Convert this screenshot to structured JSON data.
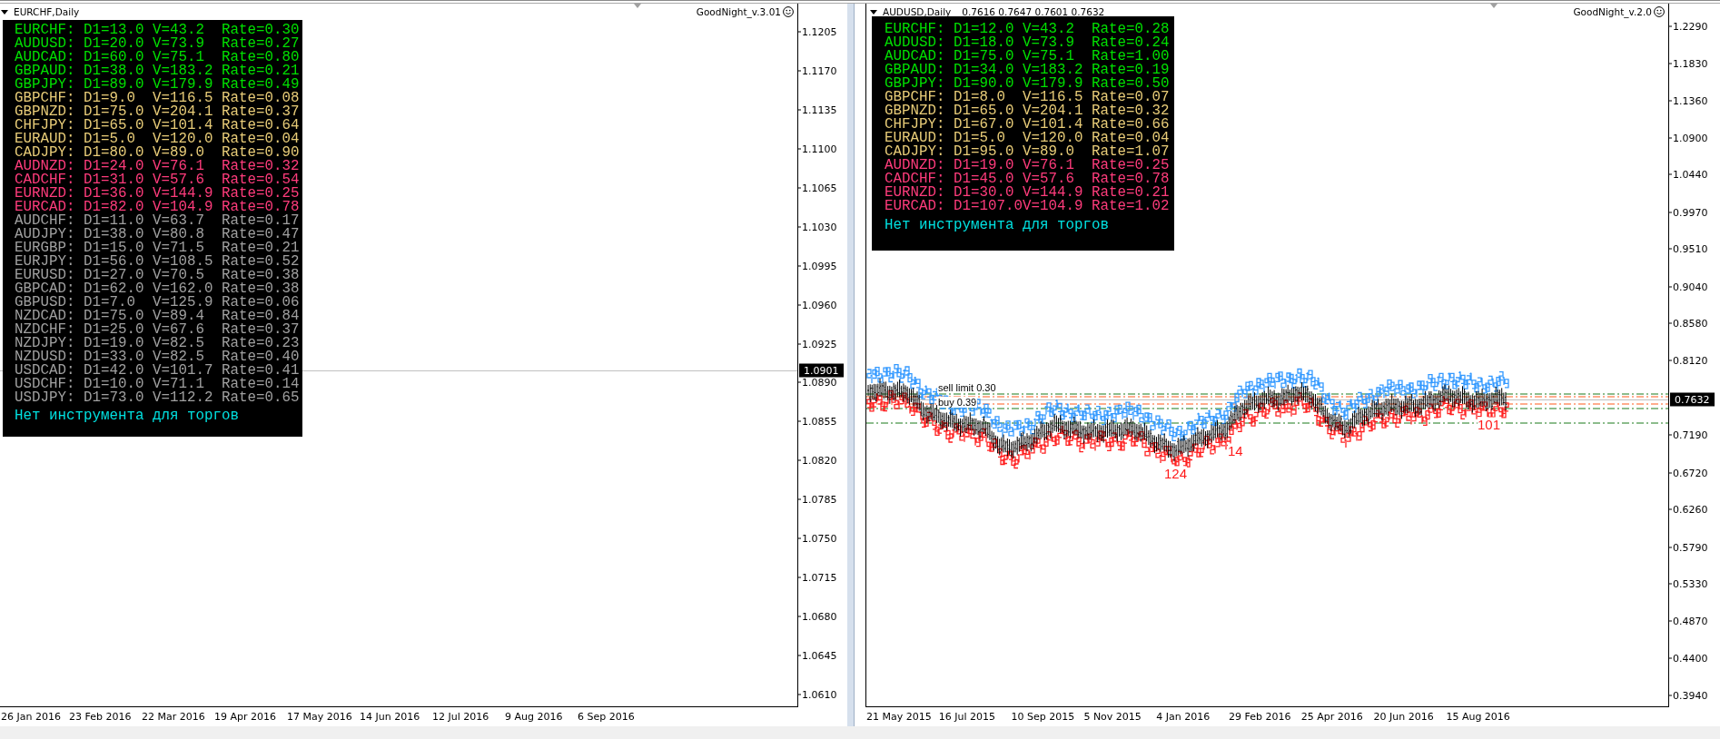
{
  "windows": [
    {
      "kind": "empty",
      "title": "EURCHF,Daily",
      "indicator": "GoodNight_v.3.01",
      "panel": {
        "rows": [
          {
            "pair": "EURCHF:",
            "d1": "D1=13.0",
            "v": "V=43.2",
            "rate": "Rate=0.30",
            "color": "#00e000"
          },
          {
            "pair": "AUDUSD:",
            "d1": "D1=20.0",
            "v": "V=73.9",
            "rate": "Rate=0.27",
            "color": "#00e000"
          },
          {
            "pair": "AUDCAD:",
            "d1": "D1=60.0",
            "v": "V=75.1",
            "rate": "Rate=0.80",
            "color": "#00e000"
          },
          {
            "pair": "GBPAUD:",
            "d1": "D1=38.0",
            "v": "V=183.2",
            "rate": "Rate=0.21",
            "color": "#00e000"
          },
          {
            "pair": "GBPJPY:",
            "d1": "D1=89.0",
            "v": "V=179.9",
            "rate": "Rate=0.49",
            "color": "#00e000"
          },
          {
            "pair": "GBPCHF:",
            "d1": "D1=9.0",
            "v": "V=116.5",
            "rate": "Rate=0.08",
            "color": "#e8cc78"
          },
          {
            "pair": "GBPNZD:",
            "d1": "D1=75.0",
            "v": "V=204.1",
            "rate": "Rate=0.37",
            "color": "#e8cc78"
          },
          {
            "pair": "CHFJPY:",
            "d1": "D1=65.0",
            "v": "V=101.4",
            "rate": "Rate=0.64",
            "color": "#e8cc78"
          },
          {
            "pair": "EURAUD:",
            "d1": "D1=5.0",
            "v": "V=120.0",
            "rate": "Rate=0.04",
            "color": "#e8cc78"
          },
          {
            "pair": "CADJPY:",
            "d1": "D1=80.0",
            "v": "V=89.0",
            "rate": "Rate=0.90",
            "color": "#e8cc78"
          },
          {
            "pair": "AUDNZD:",
            "d1": "D1=24.0",
            "v": "V=76.1",
            "rate": "Rate=0.32",
            "color": "#ff3c7c"
          },
          {
            "pair": "CADCHF:",
            "d1": "D1=31.0",
            "v": "V=57.6",
            "rate": "Rate=0.54",
            "color": "#ff3c7c"
          },
          {
            "pair": "EURNZD:",
            "d1": "D1=36.0",
            "v": "V=144.9",
            "rate": "Rate=0.25",
            "color": "#ff3c7c"
          },
          {
            "pair": "EURCAD:",
            "d1": "D1=82.0",
            "v": "V=104.9",
            "rate": "Rate=0.78",
            "color": "#ff3c7c"
          },
          {
            "pair": "AUDCHF:",
            "d1": "D1=11.0",
            "v": "V=63.7",
            "rate": "Rate=0.17",
            "color": "#a0a0a0"
          },
          {
            "pair": "AUDJPY:",
            "d1": "D1=38.0",
            "v": "V=80.8",
            "rate": "Rate=0.47",
            "color": "#a0a0a0"
          },
          {
            "pair": "EURGBP:",
            "d1": "D1=15.0",
            "v": "V=71.5",
            "rate": "Rate=0.21",
            "color": "#a0a0a0"
          },
          {
            "pair": "EURJPY:",
            "d1": "D1=56.0",
            "v": "V=108.5",
            "rate": "Rate=0.52",
            "color": "#a0a0a0"
          },
          {
            "pair": "EURUSD:",
            "d1": "D1=27.0",
            "v": "V=70.5",
            "rate": "Rate=0.38",
            "color": "#a0a0a0"
          },
          {
            "pair": "GBPCAD:",
            "d1": "D1=62.0",
            "v": "V=162.0",
            "rate": "Rate=0.38",
            "color": "#a0a0a0"
          },
          {
            "pair": "GBPUSD:",
            "d1": "D1=7.0",
            "v": "V=125.9",
            "rate": "Rate=0.06",
            "color": "#a0a0a0"
          },
          {
            "pair": "NZDCAD:",
            "d1": "D1=75.0",
            "v": "V=89.4",
            "rate": "Rate=0.84",
            "color": "#a0a0a0"
          },
          {
            "pair": "NZDCHF:",
            "d1": "D1=25.0",
            "v": "V=67.6",
            "rate": "Rate=0.37",
            "color": "#a0a0a0"
          },
          {
            "pair": "NZDJPY:",
            "d1": "D1=19.0",
            "v": "V=82.5",
            "rate": "Rate=0.23",
            "color": "#a0a0a0"
          },
          {
            "pair": "NZDUSD:",
            "d1": "D1=33.0",
            "v": "V=82.5",
            "rate": "Rate=0.40",
            "color": "#a0a0a0"
          },
          {
            "pair": "USDCAD:",
            "d1": "D1=42.0",
            "v": "V=101.7",
            "rate": "Rate=0.41",
            "color": "#a0a0a0"
          },
          {
            "pair": "USDCHF:",
            "d1": "D1=10.0",
            "v": "V=71.1",
            "rate": "Rate=0.14",
            "color": "#a0a0a0"
          },
          {
            "pair": "USDJPY:",
            "d1": "D1=73.0",
            "v": "V=112.2",
            "rate": "Rate=0.65",
            "color": "#a0a0a0"
          }
        ],
        "message": "Нет инструмента для торгов"
      },
      "price_axis": {
        "labels": [
          "1.1205",
          "1.1170",
          "1.1135",
          "1.1100",
          "1.1065",
          "1.1030",
          "1.0995",
          "1.0960",
          "1.0925",
          "1.0890",
          "1.0855",
          "1.0820",
          "1.0785",
          "1.0750",
          "1.0715",
          "1.0680",
          "1.0645",
          "1.0610"
        ],
        "current": "1.0901"
      },
      "time_axis": [
        "26 Jan 2016",
        "23 Feb 2016",
        "22 Mar 2016",
        "19 Apr 2016",
        "17 May 2016",
        "14 Jun 2016",
        "12 Jul 2016",
        "9 Aug 2016",
        "6 Sep 2016"
      ]
    },
    {
      "kind": "bars",
      "title": "AUDUSD,Daily",
      "quote": "0.7616 0.7647 0.7601 0.7632",
      "indicator": "GoodNight_v.2.0",
      "panel": {
        "rows": [
          {
            "pair": "EURCHF:",
            "d1": "D1=12.0",
            "v": "V=43.2",
            "rate": "Rate=0.28",
            "color": "#00e000"
          },
          {
            "pair": "AUDUSD:",
            "d1": "D1=18.0",
            "v": "V=73.9",
            "rate": "Rate=0.24",
            "color": "#00e000"
          },
          {
            "pair": "AUDCAD:",
            "d1": "D1=75.0",
            "v": "V=75.1",
            "rate": "Rate=1.00",
            "color": "#00e000"
          },
          {
            "pair": "GBPAUD:",
            "d1": "D1=34.0",
            "v": "V=183.2",
            "rate": "Rate=0.19",
            "color": "#00e000"
          },
          {
            "pair": "GBPJPY:",
            "d1": "D1=90.0",
            "v": "V=179.9",
            "rate": "Rate=0.50",
            "color": "#00e000"
          },
          {
            "pair": "GBPCHF:",
            "d1": "D1=8.0",
            "v": "V=116.5",
            "rate": "Rate=0.07",
            "color": "#e8cc78"
          },
          {
            "pair": "GBPNZD:",
            "d1": "D1=65.0",
            "v": "V=204.1",
            "rate": "Rate=0.32",
            "color": "#e8cc78"
          },
          {
            "pair": "CHFJPY:",
            "d1": "D1=67.0",
            "v": "V=101.4",
            "rate": "Rate=0.66",
            "color": "#e8cc78"
          },
          {
            "pair": "EURAUD:",
            "d1": "D1=5.0",
            "v": "V=120.0",
            "rate": "Rate=0.04",
            "color": "#e8cc78"
          },
          {
            "pair": "CADJPY:",
            "d1": "D1=95.0",
            "v": "V=89.0",
            "rate": "Rate=1.07",
            "color": "#e8cc78"
          },
          {
            "pair": "AUDNZD:",
            "d1": "D1=19.0",
            "v": "V=76.1",
            "rate": "Rate=0.25",
            "color": "#ff3c7c"
          },
          {
            "pair": "CADCHF:",
            "d1": "D1=45.0",
            "v": "V=57.6",
            "rate": "Rate=0.78",
            "color": "#ff3c7c"
          },
          {
            "pair": "EURNZD:",
            "d1": "D1=30.0",
            "v": "V=144.9",
            "rate": "Rate=0.21",
            "color": "#ff3c7c"
          },
          {
            "pair": "EURCAD:",
            "d1": "D1=107.0",
            "v": "V=104.9",
            "rate": "Rate=1.02",
            "color": "#ff3c7c"
          }
        ],
        "message": "Нет инструмента для торгов"
      },
      "price_axis": {
        "labels": [
          "1.2290",
          "1.1830",
          "1.1360",
          "1.0900",
          "1.0440",
          "0.9970",
          "0.9510",
          "0.9040",
          "0.8580",
          "0.8120",
          "0.7190",
          "0.6720",
          "0.6260",
          "0.5790",
          "0.5330",
          "0.4870",
          "0.4400",
          "0.3940"
        ],
        "current": "0.7632"
      },
      "time_axis": [
        "21 May 2015",
        "16 Jul 2015",
        "10 Sep 2015",
        "5 Nov 2015",
        "4 Jan 2016",
        "29 Feb 2016",
        "25 Apr 2016",
        "20 Jun 2016",
        "15 Aug 2016"
      ],
      "order_labels": [
        "sell limit 0.30",
        "buy 0.39"
      ],
      "bar_labels": [
        {
          "text": "124",
          "kind": "low"
        },
        {
          "text": "14",
          "kind": "low"
        },
        {
          "text": "101",
          "kind": "low"
        }
      ]
    }
  ]
}
